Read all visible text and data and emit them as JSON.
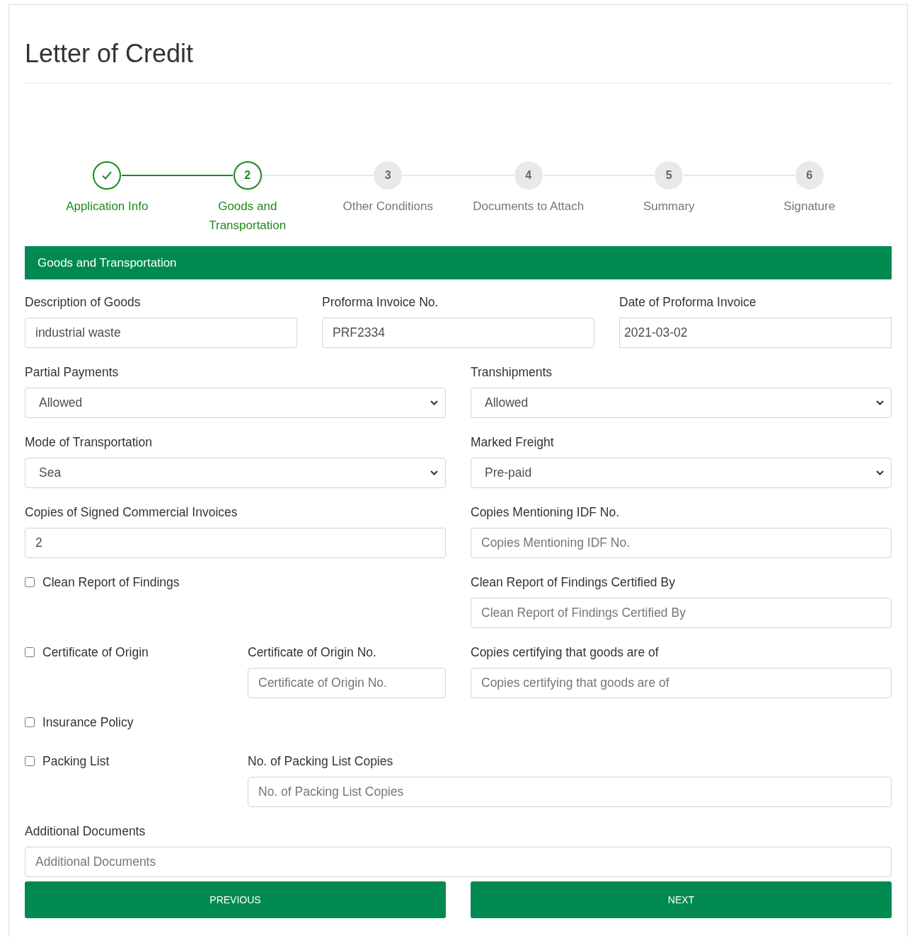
{
  "title": "Letter of Credit",
  "steps": [
    {
      "label": "Application Info",
      "completed": true,
      "selected": false
    },
    {
      "number": "2",
      "label": "Goods and Transportation",
      "completed": false,
      "selected": true
    },
    {
      "number": "3",
      "label": "Other Conditions",
      "completed": false,
      "selected": false
    },
    {
      "number": "4",
      "label": "Documents to Attach",
      "completed": false,
      "selected": false
    },
    {
      "number": "5",
      "label": "Summary",
      "completed": false,
      "selected": false
    },
    {
      "number": "6",
      "label": "Signature",
      "completed": false,
      "selected": false
    }
  ],
  "section_title": "Goods and Transportation",
  "rows": [
    {
      "fields": [
        {
          "kind": "input",
          "label": "Description of Goods",
          "value": "industrial waste"
        },
        {
          "kind": "input",
          "label": "Proforma Invoice No.",
          "value": "PRF2334"
        },
        {
          "kind": "date",
          "label": "Date of Proforma Invoice",
          "value": "2021-03-02"
        }
      ]
    },
    {
      "fields": [
        {
          "kind": "select",
          "label": "Partial Payments",
          "value": "Allowed"
        },
        {
          "kind": "select",
          "label": "Transhipments",
          "value": "Allowed"
        }
      ]
    },
    {
      "fields": [
        {
          "kind": "select",
          "label": "Mode of Transportation",
          "value": "Sea"
        },
        {
          "kind": "select",
          "label": "Marked Freight",
          "value": "Pre-paid"
        }
      ]
    },
    {
      "fields": [
        {
          "kind": "input",
          "label": "Copies of Signed Commercial Invoices",
          "value": "2"
        },
        {
          "kind": "input",
          "label": "Copies Mentioning IDF No.",
          "placeholder": "Copies Mentioning IDF No."
        }
      ]
    },
    {
      "fields": [
        {
          "kind": "checkbox",
          "label": "Clean Report of Findings",
          "checked": false
        },
        {
          "kind": "input",
          "label": "Clean Report of Findings Certified By",
          "placeholder": "Clean Report of Findings Certified By"
        }
      ]
    },
    {
      "fields": [
        {
          "kind": "checkbox",
          "label": "Certificate of Origin",
          "checked": false
        },
        {
          "kind": "input",
          "label": "Certificate of Origin No.",
          "placeholder": "Certificate of Origin No."
        },
        {
          "kind": "input",
          "label": "Copies certifying that goods are of",
          "placeholder": "Copies certifying that goods are of"
        }
      ]
    },
    {
      "fields": [
        {
          "kind": "checkbox",
          "label": "Insurance Policy",
          "checked": false
        }
      ]
    },
    {
      "fields": [
        {
          "kind": "checkbox",
          "label": "Packing List",
          "checked": false
        },
        {
          "kind": "input",
          "label": "No. of Packing List Copies",
          "placeholder": "No. of Packing List Copies"
        }
      ]
    },
    {
      "fields": [
        {
          "kind": "input",
          "label": "Additional Documents",
          "placeholder": "Additional Documents"
        }
      ]
    }
  ],
  "buttons": [
    {
      "label": "PREVIOUS"
    },
    {
      "label": "NEXT"
    }
  ]
}
